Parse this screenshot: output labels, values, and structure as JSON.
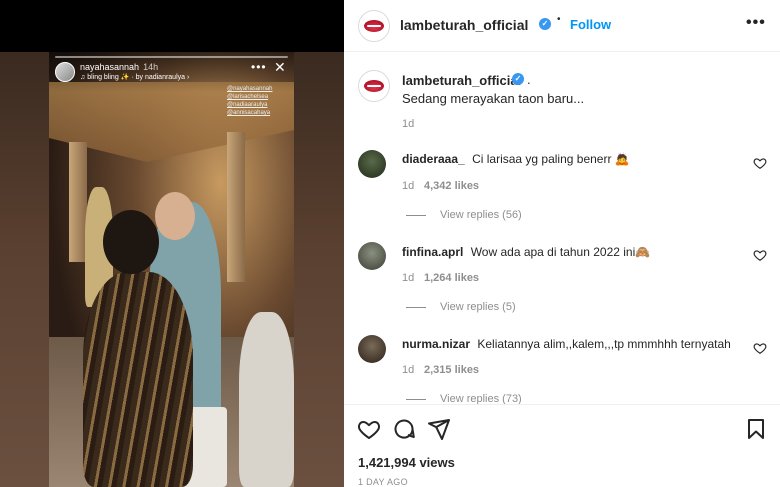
{
  "story": {
    "username": "nayahasannah",
    "time": "14h",
    "music": "♫ bling bling ✨ · by nadianraulya ›",
    "tags": [
      "@nayahasannah",
      "@larisachelsea",
      "@nadiaaraulya",
      "@annisacahaya"
    ],
    "more_label": "•••",
    "close_label": "✕"
  },
  "header": {
    "username": "lambeturah_official",
    "verified_glyph": "✓",
    "separator": "•",
    "follow_label": "Follow",
    "more_label": "•••"
  },
  "caption": {
    "username": "lambeturah_official",
    "suffix": ".",
    "text": "Sedang merayakan taon baru...",
    "age": "1d"
  },
  "comments": [
    {
      "username": "diaderaaa_",
      "text": "Ci larisaa yg paling benerr 🙇",
      "age": "1d",
      "likes": "4,342 likes",
      "replies": "View replies (56)"
    },
    {
      "username": "finfina.aprl",
      "text": "Wow ada apa di tahun 2022 ini🙈",
      "age": "1d",
      "likes": "1,264 likes",
      "replies": "View replies (5)"
    },
    {
      "username": "nurma.nizar",
      "text": "Keliatannya alim,,kalem,,,tp mmmhhh ternyatah",
      "age": "1d",
      "likes": "2,315 likes",
      "replies": "View replies (73)"
    }
  ],
  "footer": {
    "views": "1,421,994 views",
    "date": "1 DAY AGO"
  },
  "icons": [
    "heart-icon",
    "comment-icon",
    "share-icon",
    "bookmark-icon"
  ],
  "colors": {
    "link": "#0095f6",
    "verified": "#3897f0",
    "muted": "#8e8e8e"
  }
}
